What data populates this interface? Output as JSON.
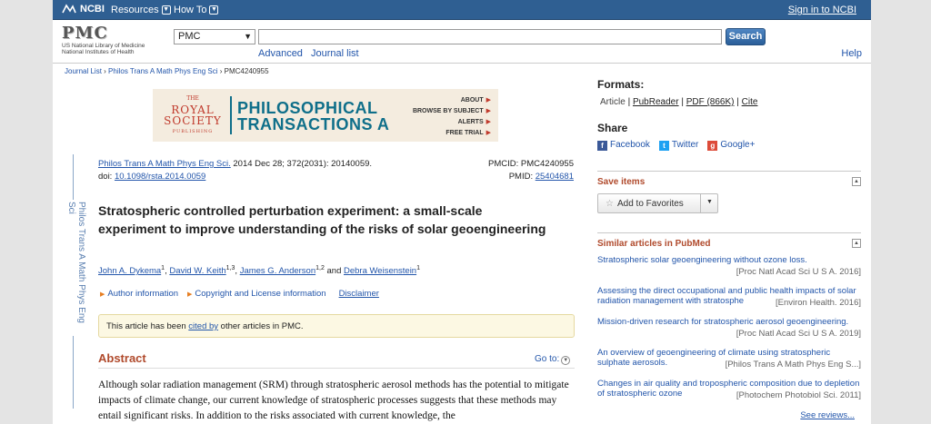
{
  "topbar": {
    "ncbi": "NCBI",
    "resources": "Resources",
    "howto": "How To",
    "signin": "Sign in to NCBI"
  },
  "search": {
    "logo": "PMC",
    "logo_sub1": "US National Library of Medicine",
    "logo_sub2": "National Institutes of Health",
    "db": "PMC",
    "button": "Search",
    "advanced": "Advanced",
    "journal_list": "Journal list",
    "help": "Help"
  },
  "breadcrumb": {
    "journal_list": "Journal List",
    "sep": " › ",
    "journal": "Philos Trans A Math Phys Eng Sci",
    "pmcid": "PMC4240955"
  },
  "banner": {
    "the": "THE",
    "royal": "ROYAL",
    "society": "SOCIETY",
    "publishing": "PUBLISHING",
    "line1": "PHILOSOPHICAL",
    "line2": "TRANSACTIONS A",
    "links": [
      "ABOUT",
      "BROWSE BY SUBJECT",
      "ALERTS",
      "FREE TRIAL"
    ]
  },
  "sidebar_title": "Philos Trans A Math Phys Eng Sci",
  "citation": {
    "journal": "Philos Trans A Math Phys Eng Sci.",
    "date": " 2014 Dec 28; 372(2031): 20140059.",
    "doi_label": "doi: ",
    "doi": "10.1098/rsta.2014.0059",
    "pmcid": "PMCID: PMC4240955",
    "pmid_label": "PMID: ",
    "pmid": "25404681"
  },
  "article": {
    "title": "Stratospheric controlled perturbation experiment: a small-scale experiment to improve understanding of the risks of solar geoengineering",
    "authors": [
      {
        "name": "John A. Dykema",
        "sup": "1"
      },
      {
        "name": "David W. Keith",
        "sup": "1,3"
      },
      {
        "name": "James G. Anderson",
        "sup": "1,2"
      },
      {
        "name": "Debra Weisenstein",
        "sup": "1"
      }
    ],
    "and": " and ",
    "author_info": "Author information",
    "copyright": "Copyright and License information",
    "disclaimer": "Disclaimer",
    "cited_pre": "This article has been ",
    "cited_link": "cited by",
    "cited_post": " other articles in PMC.",
    "abstract_head": "Abstract",
    "goto": "Go to:",
    "abstract_text": "Although solar radiation management (SRM) through stratospheric aerosol methods has the potential to mitigate impacts of climate change, our current knowledge of stratospheric processes suggests that these methods may entail significant risks. In addition to the risks associated with current knowledge, the"
  },
  "right": {
    "formats_head": "Formats:",
    "formats": [
      "Article",
      "PubReader",
      "PDF (866K)",
      "Cite"
    ],
    "share_head": "Share",
    "share": [
      "Facebook",
      "Twitter",
      "Google+"
    ],
    "save_head": "Save items",
    "add_fav": "Add to Favorites",
    "similar_head": "Similar articles in PubMed",
    "similar": [
      {
        "title": "Stratospheric solar geoengineering without ozone loss.",
        "src": "[Proc Natl Acad Sci U S A. 2016]"
      },
      {
        "title": "Assessing the direct occupational and public health impacts of solar radiation management with stratosphe",
        "src": "[Environ Health. 2016]"
      },
      {
        "title": "Mission-driven research for stratospheric aerosol geoengineering.",
        "src": "[Proc Natl Acad Sci U S A. 2019]"
      },
      {
        "title": "An overview of geoengineering of climate using stratospheric sulphate aerosols.",
        "src": "[Philos Trans A Math Phys Eng S...]"
      },
      {
        "title": "Changes in air quality and tropospheric composition due to depletion of stratospheric ozone",
        "src": "[Photochem Photobiol Sci. 2011]"
      }
    ],
    "see_reviews": "See reviews..."
  }
}
